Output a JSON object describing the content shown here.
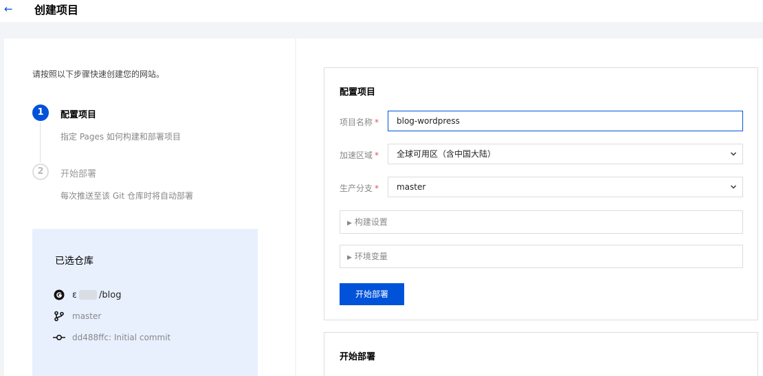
{
  "header": {
    "title": "创建项目"
  },
  "left": {
    "intro": "请按照以下步骤快速创建您的网站。",
    "steps": [
      {
        "number": "1",
        "title": "配置项目",
        "desc": "指定 Pages 如何构建和部署项目"
      },
      {
        "number": "2",
        "title": "开始部署",
        "desc": "每次推送至该 Git 仓库时将自动部署"
      }
    ],
    "repo": {
      "title": "已选仓库",
      "name_prefix": "ε",
      "name_suffix": "/blog",
      "branch": "master",
      "commit": "dd488ffc: Initial commit"
    }
  },
  "config": {
    "title": "配置项目",
    "fields": [
      {
        "label": "项目名称",
        "required": "*",
        "value": "blog-wordpress"
      },
      {
        "label": "加速区域",
        "required": "*",
        "value": "全球可用区（含中国大陆）"
      },
      {
        "label": "生产分支",
        "required": "*",
        "value": "master"
      }
    ],
    "collapses": [
      {
        "label": "构建设置"
      },
      {
        "label": "环境变量"
      }
    ],
    "submit_label": "开始部署"
  },
  "deploy": {
    "title": "开始部署"
  },
  "colors": {
    "primary": "#0052d9",
    "required": "#e34d59",
    "repo_bg": "#e8f0fe",
    "page_bg": "#f3f4f7"
  }
}
